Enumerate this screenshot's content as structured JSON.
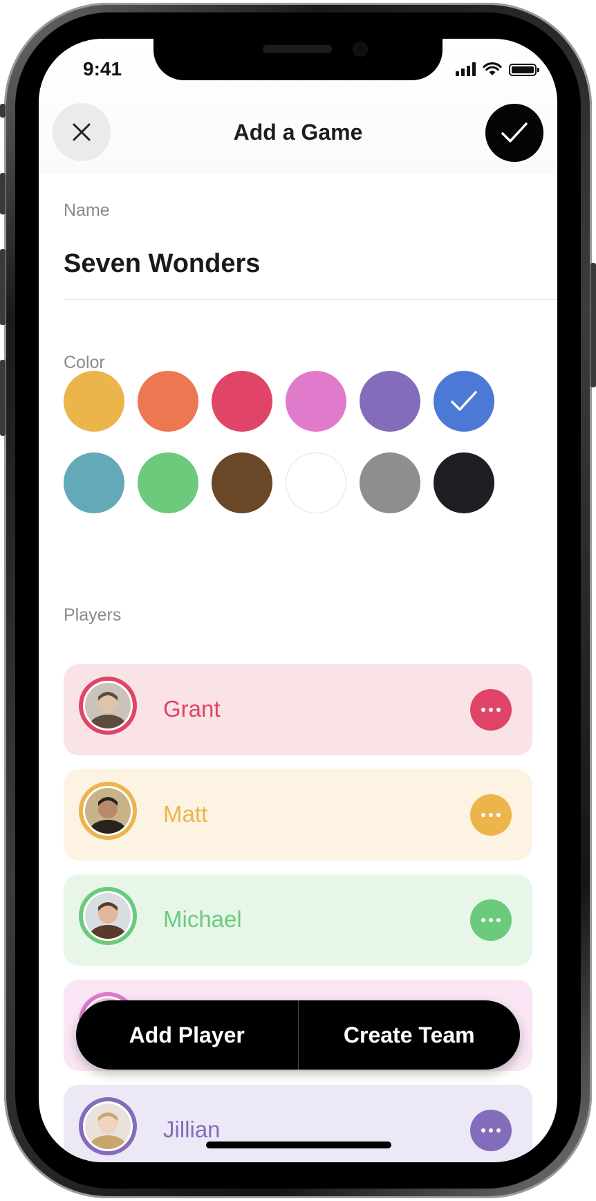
{
  "status_bar": {
    "time": "9:41"
  },
  "header": {
    "title": "Add a Game",
    "close_icon": "close-icon",
    "confirm_icon": "checkmark-icon"
  },
  "name_section": {
    "label": "Name",
    "value": "Seven Wonders"
  },
  "color_section": {
    "label": "Color",
    "swatches": [
      {
        "name": "yellow",
        "hex": "#EBB54B",
        "selected": false
      },
      {
        "name": "orange",
        "hex": "#EC7750",
        "selected": false
      },
      {
        "name": "red",
        "hex": "#E04467",
        "selected": false
      },
      {
        "name": "pink",
        "hex": "#E07ACB",
        "selected": false
      },
      {
        "name": "purple",
        "hex": "#836DBA",
        "selected": false
      },
      {
        "name": "blue",
        "hex": "#4D79D6",
        "selected": true
      },
      {
        "name": "teal",
        "hex": "#64A9B7",
        "selected": false
      },
      {
        "name": "green",
        "hex": "#6BCA7B",
        "selected": false
      },
      {
        "name": "brown",
        "hex": "#694727",
        "selected": false
      },
      {
        "name": "white",
        "hex": "#FFFFFF",
        "selected": false
      },
      {
        "name": "gray",
        "hex": "#8E8E8E",
        "selected": false
      },
      {
        "name": "black",
        "hex": "#1D1F22",
        "selected": false
      }
    ]
  },
  "players_section": {
    "label": "Players",
    "players": [
      {
        "name": "Grant",
        "accent": "#E04467",
        "background": "#FAE3E7"
      },
      {
        "name": "Matt",
        "accent": "#EBB54B",
        "background": "#FDF3E3"
      },
      {
        "name": "Michael",
        "accent": "#6BCA7B",
        "background": "#E8F6EA"
      },
      {
        "name": "",
        "accent": "#E07ACB",
        "background": "#FAE6F5"
      },
      {
        "name": "Jillian",
        "accent": "#836DBA",
        "background": "#ECE8F5"
      }
    ],
    "more_icon": "more-dots-icon"
  },
  "actions": {
    "add_player": "Add Player",
    "create_team": "Create Team"
  }
}
